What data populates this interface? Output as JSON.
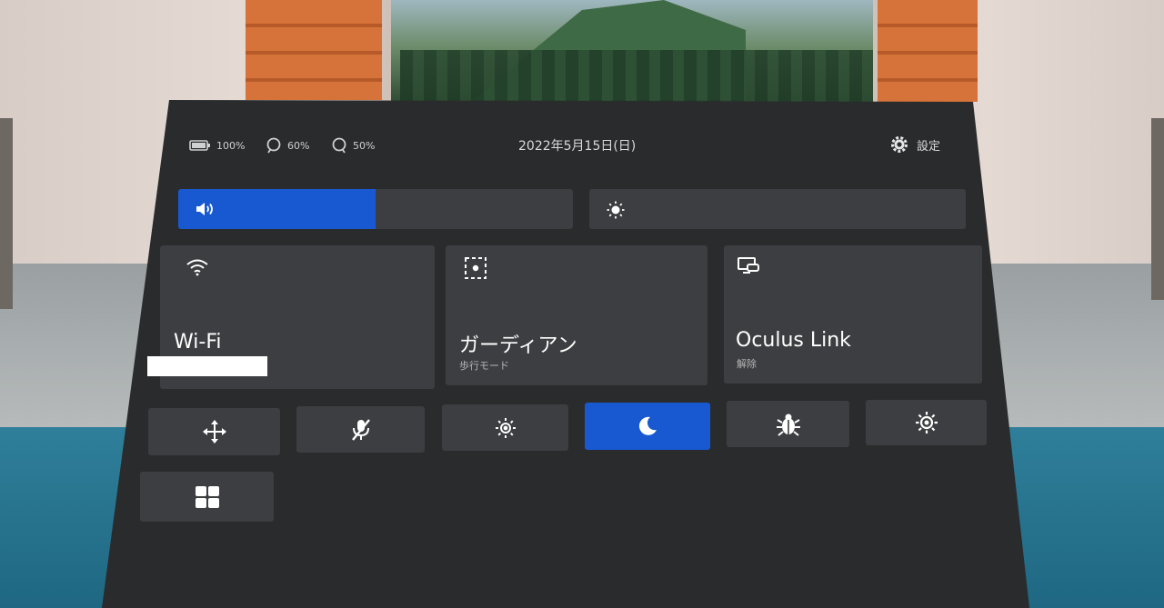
{
  "status_bar": {
    "headset_battery": "100%",
    "left_controller_battery": "60%",
    "right_controller_battery": "50%",
    "date": "2022年5月15日(日)",
    "settings_label": "設定"
  },
  "sliders": {
    "volume": {
      "icon": "volume-icon",
      "level_percent": 50
    },
    "brightness": {
      "icon": "brightness-icon",
      "level_percent": 0
    }
  },
  "tiles": {
    "wifi": {
      "icon": "wifi-icon",
      "title": "Wi-Fi"
    },
    "guardian": {
      "icon": "guardian-icon",
      "title": "ガーディアン",
      "subtitle": "歩行モード"
    },
    "oculus_link": {
      "icon": "oculus-link-icon",
      "title": "Oculus Link",
      "subtitle": "解除"
    }
  },
  "quick_actions": [
    {
      "icon": "move-icon",
      "active": false
    },
    {
      "icon": "mic-muted-icon",
      "active": false
    },
    {
      "icon": "brightness-icon",
      "active": false
    },
    {
      "icon": "night-mode-icon",
      "active": true
    },
    {
      "icon": "bug-report-icon",
      "active": false
    },
    {
      "icon": "passthrough-icon",
      "active": false
    },
    {
      "icon": "grid-apps-icon",
      "active": false
    }
  ],
  "colors": {
    "accent": "#1859d1",
    "panel": "#2a2b2d",
    "tile": "#3d3e41"
  }
}
